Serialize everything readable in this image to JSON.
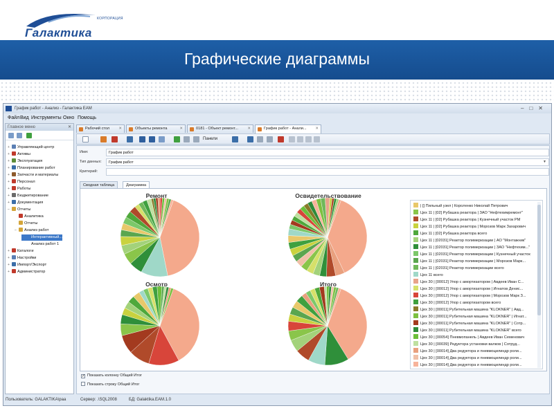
{
  "slide": {
    "logo_small": "КОРПОРАЦИЯ",
    "logo_name": "Галактика",
    "title": "Графические диаграммы"
  },
  "app": {
    "title": "График работ - Анализ - Галактика ЕАМ",
    "menu": [
      "Файл",
      "Вид",
      "Инструменты",
      "Окно",
      "Помощь"
    ]
  },
  "nav": {
    "header": "Главное меню",
    "items": [
      {
        "label": "Управляющий центр",
        "color": "#5b7fb4"
      },
      {
        "label": "Активы",
        "color": "#c0392b"
      },
      {
        "label": "Эксплуатация",
        "color": "#5d8d3a"
      },
      {
        "label": "Планирование работ",
        "color": "#3b6ea8"
      },
      {
        "label": "Запчасти и материалы",
        "color": "#8e5a2b"
      },
      {
        "label": "Персонал",
        "color": "#c0392b"
      },
      {
        "label": "Работы",
        "color": "#c0392b"
      },
      {
        "label": "Бюджетирование",
        "color": "#6a6a6a"
      },
      {
        "label": "Документация",
        "color": "#3b6ea8"
      },
      {
        "label": "Отчеты",
        "color": "#d4a53a"
      },
      {
        "label": "Аналитика",
        "color": "#c0392b"
      },
      {
        "label": "Отчеты",
        "color": "#d4a53a"
      },
      {
        "label": "Анализ работ",
        "color": "#d4a53a"
      },
      {
        "label": "Интерактивный...",
        "color": "#3c78c8"
      },
      {
        "label": "Анализ работ 1",
        "color": "#ffffff"
      },
      {
        "label": "Каталоги",
        "color": "#c0392b"
      },
      {
        "label": "Настройки",
        "color": "#5b7fb4"
      },
      {
        "label": "Импорт/Экспорт",
        "color": "#3b6ea8"
      },
      {
        "label": "Администратор",
        "color": "#c0392b"
      }
    ]
  },
  "tabs": [
    "Рабочий стол",
    "Объекты ремонта",
    "0181 - Объект ремонт...",
    "График работ - Анали..."
  ],
  "toolbar": {
    "panels_label": "Панели"
  },
  "form": {
    "name_label": "Имя:",
    "name_value": "График работ",
    "type_label": "Тип данных:",
    "type_value": "График работ",
    "criteria_label": "Критерий:",
    "criteria_value": ""
  },
  "subtabs": [
    "Сводная таблица",
    "Диаграмма"
  ],
  "charts_titles": [
    "Ремонт",
    "Освидетельствование",
    "Осмотр",
    "Итого"
  ],
  "legend": [
    {
      "label": "| [] Пильный узел | Короленко Николай Петрович",
      "color": "#e8c86a"
    },
    {
      "label": "Цех 11 | [02] Рубашка реактора | ЗАО \"Нефтехимремонт\"",
      "color": "#8ac54a"
    },
    {
      "label": "Цех 11 | [02] Рубашка реактора | Кузнечный участок РМ",
      "color": "#b04a2a"
    },
    {
      "label": "Цех 11 | [02] Рубашка реактора | Морозов Марк Захарович",
      "color": "#c9d23f"
    },
    {
      "label": "Цех 11 | [02] Рубашка реактора всего",
      "color": "#4fa83b"
    },
    {
      "label": "Цех 11 | [02031] Реактор полимеризации | АО \"Монтажник\"",
      "color": "#a3d27a"
    },
    {
      "label": "Цех 11 | [02031] Реактор полимеризации | ЗАО \"Нефтехим...\"",
      "color": "#2f8f3a"
    },
    {
      "label": "Цех 11 | [02031] Реактор полимеризации | Кузнечный участок",
      "color": "#7cc86a"
    },
    {
      "label": "Цех 11 | [02031] Реактор полимеризации | Морозов Марк...",
      "color": "#5aa64f"
    },
    {
      "label": "Цех 11 | [02031] Реактор полимеризации всего",
      "color": "#6fb85a"
    },
    {
      "label": "Цех 11 всего",
      "color": "#9fd8c8"
    },
    {
      "label": "Цех 30 | [00012] Упор с амортизатором | Авдеев Иван С...",
      "color": "#e8a38a"
    },
    {
      "label": "Цех 30 | [00012] Упор с амортизатором | Игнатов Денис...",
      "color": "#d6e06a"
    },
    {
      "label": "Цех 30 | [00012] Упор с амортизатором | Морозов Марк З...",
      "color": "#d8453a"
    },
    {
      "label": "Цех 30 | [00012] Упор с амортизатором всего",
      "color": "#3fa03f"
    },
    {
      "label": "Цех 30 | [00011] Рубительная машина \"KLOKNER\" | Авд...",
      "color": "#8a7a2a"
    },
    {
      "label": "Цех 30 | [00011] Рубительная машина \"KLOKNER\" | Игнат...",
      "color": "#7cc040"
    },
    {
      "label": "Цех 30 | [00011] Рубительная машина \"KLOKNER\" | Сотр...",
      "color": "#a33a1f"
    },
    {
      "label": "Цех 30 | [00011] Рубительная машина \"KLOKNER\" всего",
      "color": "#2e8b3a"
    },
    {
      "label": "Цех 30 | [00054] Пневмопанель | Авдеев Иван Семенович",
      "color": "#6bbf3a"
    },
    {
      "label": "Цех 30 | [00039] Редуктора установки валков | Сотруд...",
      "color": "#bfe0a0"
    },
    {
      "label": "Цех 30 | [00014] Два редуктора и пневмоцилиндр роли...",
      "color": "#e9a07e"
    },
    {
      "label": "Цех 30 | [00014] Два редуктора и пневмоцилиндр роли...",
      "color": "#f0c0a8"
    },
    {
      "label": "Цех 30 | [00014] Два редуктора и пневмоцилиндр роли...",
      "color": "#f7b39a"
    }
  ],
  "checkboxes": [
    {
      "label": "Показать колонку Общий Итог",
      "checked": true
    },
    {
      "label": "Показать строку Общий Итог",
      "checked": false
    }
  ],
  "status": {
    "user": "Пользователь: GALAKTIKA\\paa",
    "server": "Сервер: .\\SQL2008",
    "db": "БД: Galaktika.EAM.1.0"
  },
  "chart_data": [
    {
      "type": "pie",
      "title": "Ремонт",
      "values": [
        45,
        12,
        6,
        5,
        4,
        4,
        3,
        3,
        3,
        3,
        3,
        2,
        2,
        2,
        2,
        1,
        1,
        1,
        1,
        1,
        1,
        1,
        1,
        1,
        1
      ],
      "colors": [
        "#f4a98c",
        "#9fd8c8",
        "#2f8f3a",
        "#8ac54a",
        "#a3d27a",
        "#c9d23f",
        "#5aa64f",
        "#e8c86a",
        "#7cc86a",
        "#4fa83b",
        "#b04a2a",
        "#d6e06a",
        "#6fb85a",
        "#3fa03f",
        "#bfe0a0",
        "#8a7a2a",
        "#2e8b3a",
        "#a33a1f",
        "#e9a07e",
        "#d8453a",
        "#6bbf3a",
        "#f0c0a8",
        "#7cc040",
        "#5aa64f",
        "#f7b39a"
      ]
    },
    {
      "type": "pie",
      "title": "Освидетельствование",
      "values": [
        40,
        4,
        4,
        3,
        3,
        3,
        3,
        3,
        3,
        3,
        3,
        3,
        3,
        2,
        2,
        2,
        2,
        2,
        2,
        2,
        2,
        2,
        2,
        2,
        2,
        1,
        1,
        1,
        1,
        1
      ],
      "colors": [
        "#f4a98c",
        "#e9a07e",
        "#b04a2a",
        "#2f8f3a",
        "#a3d27a",
        "#d6e06a",
        "#8ac54a",
        "#f0c0a8",
        "#5aa64f",
        "#c9d23f",
        "#3fa03f",
        "#e8c86a",
        "#9fd8c8",
        "#7cc86a",
        "#a33a1f",
        "#4fa83b",
        "#bfe0a0",
        "#d8453a",
        "#6bbf3a",
        "#8a7a2a",
        "#2e8b3a",
        "#f7b39a",
        "#7cc040",
        "#6fb85a",
        "#e8a38a",
        "#c9d23f",
        "#b04a2a",
        "#2f8f3a",
        "#a3d27a",
        "#f4a98c"
      ]
    },
    {
      "type": "pie",
      "title": "Осмотр",
      "values": [
        38,
        13,
        9,
        8,
        5,
        4,
        3,
        3,
        3,
        3,
        2,
        2,
        2,
        2,
        2,
        1,
        1,
        1,
        1,
        1
      ],
      "colors": [
        "#f4a98c",
        "#d8453a",
        "#b04a2a",
        "#a33a1f",
        "#8ac54a",
        "#2f8f3a",
        "#c9d23f",
        "#a3d27a",
        "#4fa83b",
        "#e8c86a",
        "#9fd8c8",
        "#7cc86a",
        "#d6e06a",
        "#3fa03f",
        "#6bbf3a",
        "#5aa64f",
        "#bfe0a0",
        "#2e8b3a",
        "#e9a07e",
        "#7cc040"
      ]
    },
    {
      "type": "pie",
      "title": "Итого",
      "values": [
        36,
        10,
        7,
        6,
        5,
        4,
        4,
        3,
        3,
        3,
        3,
        2,
        2,
        2,
        2,
        2,
        1,
        1,
        1,
        1,
        1,
        1,
        1
      ],
      "colors": [
        "#f4a98c",
        "#2f8f3a",
        "#9fd8c8",
        "#b04a2a",
        "#a3d27a",
        "#8ac54a",
        "#d8453a",
        "#c9d23f",
        "#5aa64f",
        "#e8c86a",
        "#3fa03f",
        "#e9a07e",
        "#7cc86a",
        "#d6e06a",
        "#4fa83b",
        "#a33a1f",
        "#bfe0a0",
        "#6bbf3a",
        "#2e8b3a",
        "#f0c0a8",
        "#7cc040",
        "#6fb85a",
        "#f7b39a"
      ]
    }
  ]
}
